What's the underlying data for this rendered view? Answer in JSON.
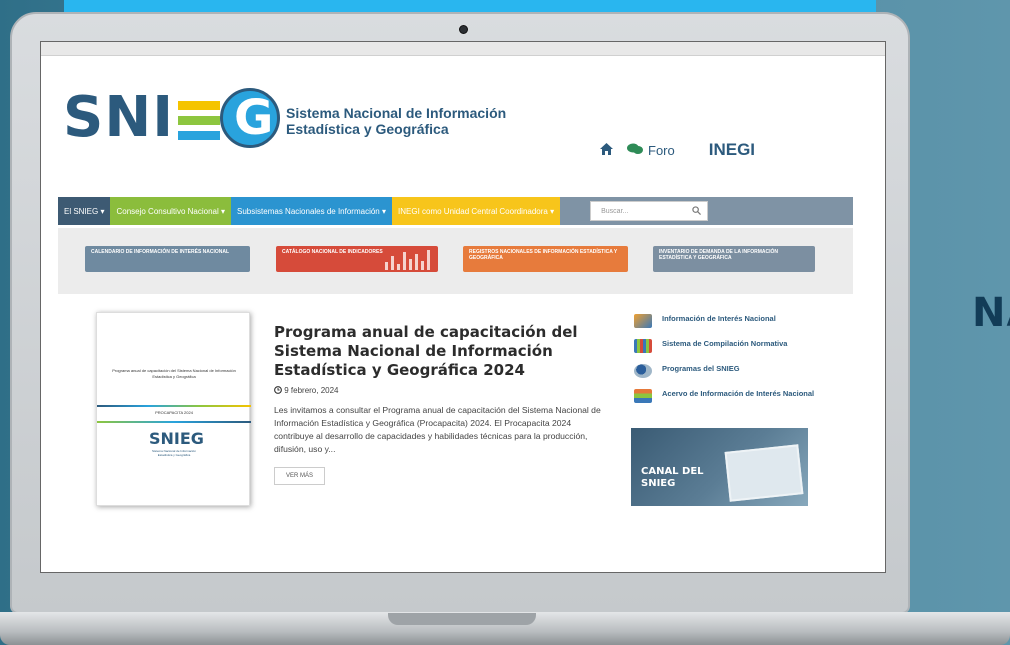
{
  "logo": {
    "letters": "SNIEG",
    "subtitle_line1": "Sistema Nacional de Información",
    "subtitle_line2": "Estadística y Geográfica"
  },
  "header": {
    "foro_label": "Foro",
    "inegi_label": "INEGI"
  },
  "nav": {
    "items": [
      {
        "label": "El SNIEG",
        "color": "#3d5a73"
      },
      {
        "label": "Consejo Consultivo Nacional",
        "color": "#8bbd3c"
      },
      {
        "label": "Subsistemas Nacionales de Información",
        "color": "#2b94d0"
      },
      {
        "label": "INEGI como Unidad Central Coordinadora",
        "color": "#f7c51b"
      }
    ],
    "search_placeholder": "Buscar..."
  },
  "banners": [
    {
      "label": "CALENDARIO DE INFORMACIÓN DE INTERÉS NACIONAL",
      "color": "#6f8aa0"
    },
    {
      "label": "CATÁLOGO NACIONAL DE INDICADORES",
      "color": "#d64b3a"
    },
    {
      "label": "REGISTROS NACIONALES DE INFORMACIÓN ESTADÍSTICA Y GEOGRÁFICA",
      "color": "#e77b3c"
    },
    {
      "label": "INVENTARIO DE DEMANDA DE LA INFORMACIÓN ESTADÍSTICA Y GEOGRÁFICA",
      "color": "#7c8fa1"
    }
  ],
  "cover": {
    "title": "Programa anual de capacitación del Sistema Nacional de Información Estadística y Geográfica",
    "year_label": "PROCAPACITA 2024",
    "mini_logo": "SNIEG",
    "mini_sub": "Sistema Nacional de Información Estadística y Geográfica"
  },
  "article": {
    "title": "Programa anual de capacitación del Sistema Nacional de Información Estadística y Geográfica 2024",
    "date": "9 febrero, 2024",
    "excerpt": "Les invitamos a consultar el Programa anual de capacitación del Sistema Nacional de Información Estadística y Geográfica (Procapacita) 2024. El Procapacita 2024 contribuye al desarrollo de capacidades y habilidades técnicas para la producción, difusión, uso y...",
    "button": "VER MÁS"
  },
  "side_links": [
    {
      "label": "Información de Interés Nacional",
      "color": "#f0a030"
    },
    {
      "label": "Sistema de Compilación Normativa",
      "color": "#3a78b8"
    },
    {
      "label": "Programas del SNIEG",
      "color": "#2b5e9b"
    },
    {
      "label": "Acervo de Información de Interés Nacional",
      "color": "#e6793a"
    }
  ],
  "canal": {
    "line1": "CANAL DEL",
    "line2": "SNIEG"
  },
  "side_text": "NA",
  "colors": {
    "brand_blue": "#2c5a7d",
    "accent_cyan": "#29b6ef",
    "logo_yellow": "#f5c400",
    "logo_green": "#8dc63f",
    "logo_light_blue": "#29a3dd"
  }
}
